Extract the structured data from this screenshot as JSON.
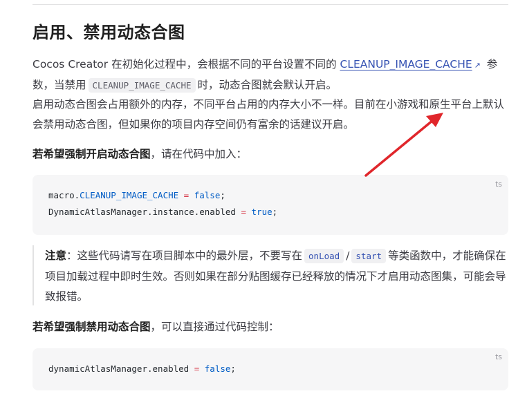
{
  "heading": "启用、禁用动态合图",
  "p1": {
    "before": "Cocos Creator 在初始化过程中，会根据不同的平台设置不同的 ",
    "link": "CLEANUP_IMAGE_CACHE",
    "link_icon": "↗",
    "mid1": " 参数，当禁用",
    "code": "CLEANUP_IMAGE_CACHE",
    "after": "时，动态合图就会默认开启。"
  },
  "p2": "启用动态合图会占用额外的内存，不同平台占用的内存大小不一样。目前在小游戏和原生平台上默认会禁用动态合图，但如果你的项目内存空间仍有富余的话建议开启。",
  "p3": {
    "strong": "若希望强制开启动态合图",
    "rest": "，请在代码中加入："
  },
  "code1": {
    "lang": "ts",
    "line1": {
      "obj": "macro.",
      "prop": "CLEANUP_IMAGE_CACHE",
      "op": " = ",
      "val": "false",
      "end": ";"
    },
    "line2": {
      "obj": "DynamicAtlasManager.instance.enabled",
      "op": " = ",
      "val": "true",
      "end": ";"
    }
  },
  "note": {
    "strong": "注意",
    "part1": "：这些代码请写在项目脚本中的最外层，不要写在",
    "code1": "onLoad",
    "slash": "/",
    "code2": "start",
    "part2": "等类函数中，才能确保在项目加载过程中即时生效。否则如果在部分贴图缓存已经释放的情况下才启用动态图集，可能会导致报错。"
  },
  "p4": {
    "strong": "若希望强制禁用动态合图",
    "rest": "，可以直接通过代码控制："
  },
  "code2": {
    "lang": "ts",
    "line1": {
      "obj": "dynamicAtlasManager.enabled",
      "op": " = ",
      "val": "false",
      "end": ";"
    }
  },
  "colors": {
    "link": "#3451b2",
    "arrow": "#e0262b",
    "code_bg": "#f6f6f7"
  }
}
